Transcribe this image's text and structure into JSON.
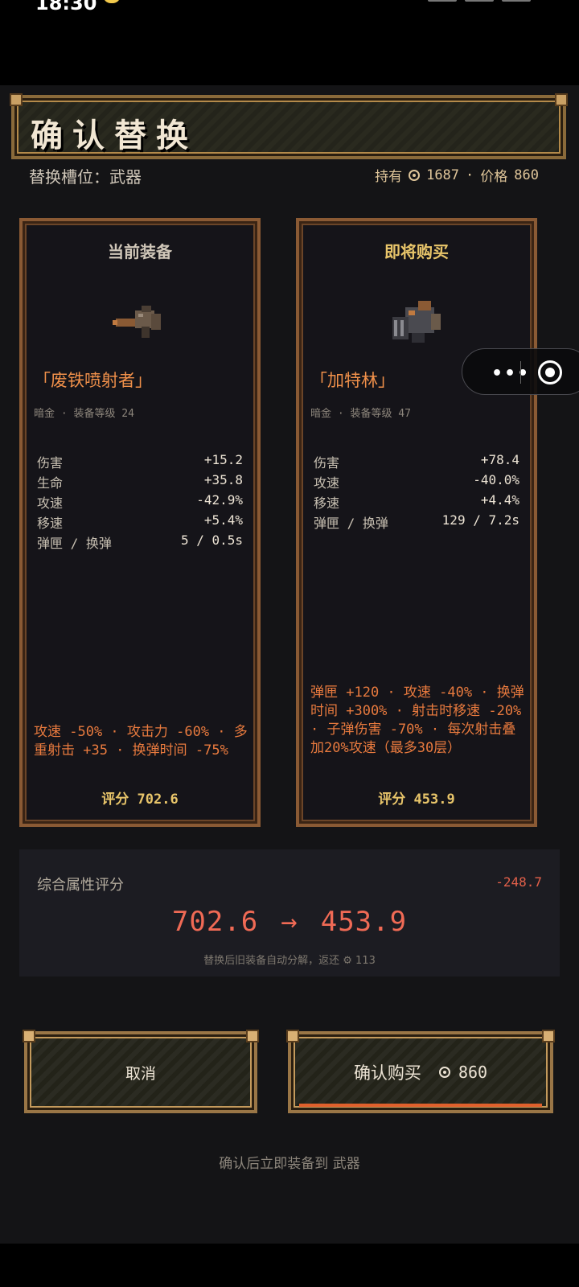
{
  "status_bar": {
    "time": "18:30"
  },
  "title": "确认替换",
  "slot_label": "替换槽位：武器",
  "holdings": {
    "owned_label": "持有",
    "owned": "1687",
    "sep": "·",
    "price_label": "价格",
    "price": "860"
  },
  "current": {
    "heading": "当前装备",
    "name": "「废铁喷射者」",
    "meta": "暗金 · 装备等级 24",
    "stats": [
      {
        "k": "伤害",
        "v": "+15.2"
      },
      {
        "k": "生命",
        "v": "+35.8"
      },
      {
        "k": "攻速",
        "v": "-42.9%"
      },
      {
        "k": "移速",
        "v": "+5.4%"
      },
      {
        "k": "弹匣 / 换弹",
        "v": "5 / 0.5s"
      }
    ],
    "special": "攻速 -50% · 攻击力 -60% · 多重射击 +35 · 换弹时间 -75%",
    "score": "评分 702.6"
  },
  "incoming": {
    "heading": "即将购买",
    "name": "「加特林」",
    "meta": "暗金 · 装备等级 47",
    "stats": [
      {
        "k": "伤害",
        "v": "+78.4"
      },
      {
        "k": "攻速",
        "v": "-40.0%"
      },
      {
        "k": "移速",
        "v": "+4.4%"
      },
      {
        "k": "弹匣 / 换弹",
        "v": "129 / 7.2s"
      }
    ],
    "special": "弹匣 +120 · 攻速 -40% · 换弹时间 +300% · 射击时移速 -20% · 子弹伤害 -70% · 每次射击叠加20%攻速（最多30层）",
    "score": "评分 453.9"
  },
  "summary": {
    "label": "综合属性评分",
    "diff": "-248.7",
    "from": "702.6",
    "arrow": "→",
    "to": "453.9",
    "note": "替换后旧装备自动分解，返还 ⚙ 113"
  },
  "buttons": {
    "cancel": "取消",
    "confirm": "确认购买",
    "confirm_price": "860"
  },
  "footer_note": "确认后立即装备到 武器",
  "colors": {
    "accent_orange": "#e87a3e",
    "gold": "#e8c56a",
    "frame": "#8a5a34",
    "score_red": "#f06a55"
  },
  "icons": [
    "gear-icon",
    "more-icon",
    "close-mini-program-icon"
  ]
}
